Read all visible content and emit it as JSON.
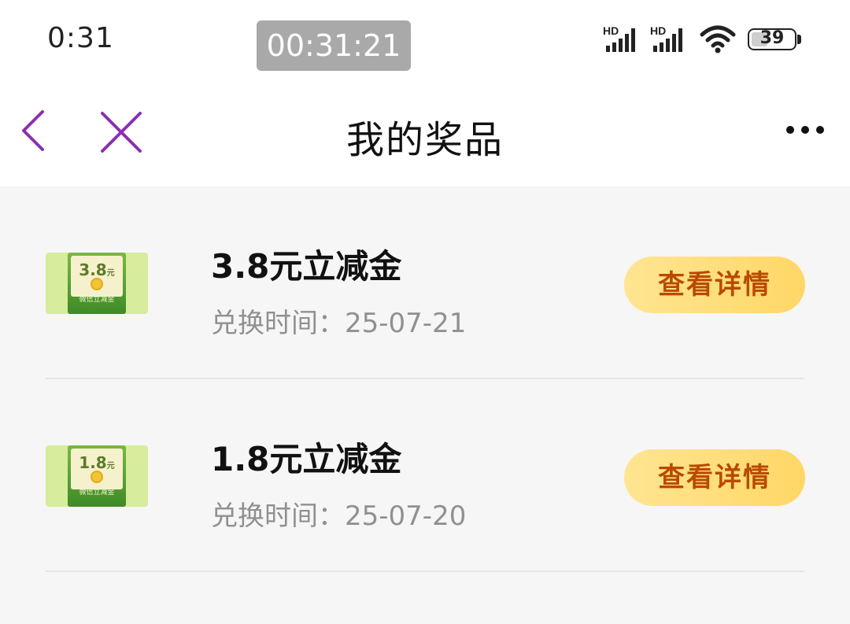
{
  "status_bar": {
    "time": "0:31",
    "recording_timer": "00:31:21",
    "network_1": "HD",
    "network_2": "HD",
    "battery": "39",
    "battery_level": 0.39,
    "icons": [
      "signal-icon",
      "signal-icon",
      "wifi-icon",
      "battery-icon"
    ]
  },
  "nav": {
    "title": "我的奖品",
    "back_icon": "chevron-left-icon",
    "close_icon": "close-icon",
    "more_icon": "more-dots-icon",
    "accent_color": "#8a2fb4"
  },
  "prizes": [
    {
      "title": "3.8元立减金",
      "time_label": "兑换时间：",
      "time_value": "25-07-21",
      "button": "查看详情",
      "thumb_amount": "3.8",
      "thumb_unit": "元",
      "thumb_caption": "微信立减金"
    },
    {
      "title": "1.8元立减金",
      "time_label": "兑换时间：",
      "time_value": "25-07-20",
      "button": "查看详情",
      "thumb_amount": "1.8",
      "thumb_unit": "元",
      "thumb_caption": "微信立减金"
    }
  ],
  "colors": {
    "button_gradient_start": "#ffe592",
    "button_gradient_end": "#ffd766",
    "button_text": "#b94a00",
    "page_bg": "#f6f6f6"
  }
}
